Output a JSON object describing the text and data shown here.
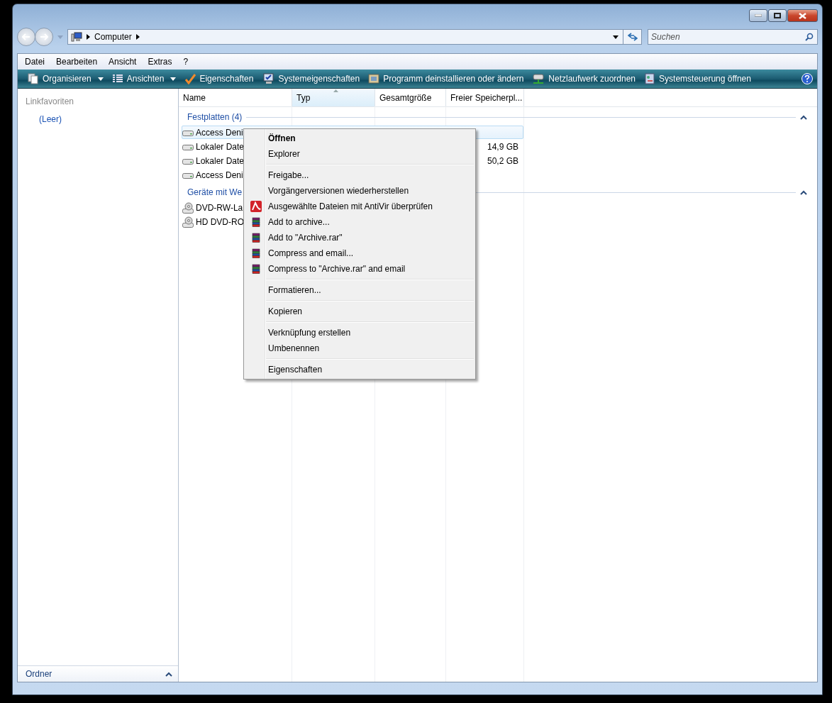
{
  "nav": {
    "crumbs": [
      "Computer"
    ],
    "search": {
      "placeholder": "Suchen"
    }
  },
  "menubar": [
    "Datei",
    "Bearbeiten",
    "Ansicht",
    "Extras",
    "?"
  ],
  "toolbar": [
    {
      "label": "Organisieren",
      "dropdown": true
    },
    {
      "label": "Ansichten",
      "dropdown": true
    },
    {
      "label": "Eigenschaften",
      "dropdown": false
    },
    {
      "label": "Systemeigenschaften",
      "dropdown": false
    },
    {
      "label": "Programm deinstallieren oder ändern",
      "dropdown": false
    },
    {
      "label": "Netzlaufwerk zuordnen",
      "dropdown": false
    },
    {
      "label": "Systemsteuerung öffnen",
      "dropdown": false
    }
  ],
  "sidebar": {
    "title": "Linkfavoriten",
    "items": [
      "(Leer)"
    ],
    "footer": "Ordner"
  },
  "columns": [
    {
      "label": "Name",
      "sorted": false
    },
    {
      "label": "Typ",
      "sorted": true
    },
    {
      "label": "Gesamtgröße",
      "sorted": false
    },
    {
      "label": "Freier Speicherpl...",
      "sorted": false
    }
  ],
  "groups": [
    {
      "title": "Festplatten (4)",
      "rows": [
        {
          "kind": "disk",
          "name": "Access Deni",
          "selected": true
        },
        {
          "kind": "disk",
          "name": "Lokaler Date",
          "selected": false,
          "free": "14,9 GB"
        },
        {
          "kind": "disk",
          "name": "Lokaler Date",
          "selected": false,
          "free": "50,2 GB"
        },
        {
          "kind": "disk",
          "name": "Access Deni",
          "selected": false
        }
      ]
    },
    {
      "title": "Geräte mit We",
      "rows": [
        {
          "kind": "optical",
          "name": "DVD-RW-La",
          "selected": false
        },
        {
          "kind": "optical",
          "name": "HD DVD-RO",
          "selected": false
        }
      ]
    }
  ],
  "context_menu": [
    [
      {
        "label": "Öffnen",
        "default": true
      },
      {
        "label": "Explorer",
        "default": false
      }
    ],
    [
      {
        "label": "Freigabe...",
        "default": false
      },
      {
        "label": "Vorgängerversionen wiederherstellen",
        "default": false
      },
      {
        "label": "Ausgewählte Dateien mit AntiVir überprüfen",
        "default": false,
        "kind": "antivirus"
      },
      {
        "label": "Add to archive...",
        "default": false,
        "kind": "archive"
      },
      {
        "label": "Add to \"Archive.rar\"",
        "default": false,
        "kind": "archive"
      },
      {
        "label": "Compress and email...",
        "default": false,
        "kind": "archive"
      },
      {
        "label": "Compress to \"Archive.rar\" and email",
        "default": false,
        "kind": "archive"
      }
    ],
    [
      {
        "label": "Formatieren...",
        "default": false
      }
    ],
    [
      {
        "label": "Kopieren",
        "default": false
      }
    ],
    [
      {
        "label": "Verknüpfung erstellen",
        "default": false
      },
      {
        "label": "Umbenennen",
        "default": false
      }
    ],
    [
      {
        "label": "Eigenschaften",
        "default": false
      }
    ]
  ]
}
